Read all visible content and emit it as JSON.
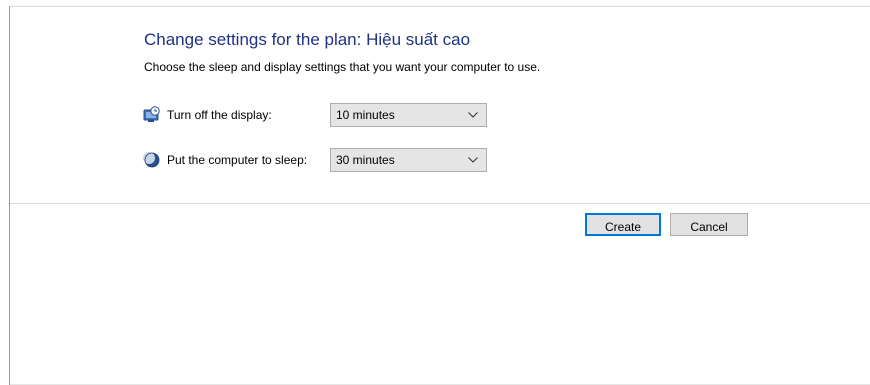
{
  "plan": {
    "title": "Change settings for the plan: Hiệu suất cao",
    "subtitle": "Choose the sleep and display settings that you want your computer to use."
  },
  "settings": [
    {
      "label": "Turn off the display:",
      "value": "10 minutes",
      "icon": "monitor-clock-icon"
    },
    {
      "label": "Put the computer to sleep:",
      "value": "30 minutes",
      "icon": "moon-icon"
    }
  ],
  "buttons": {
    "create": "Create",
    "cancel": "Cancel"
  },
  "colors": {
    "title": "#1e3287",
    "accent": "#0078d7"
  }
}
